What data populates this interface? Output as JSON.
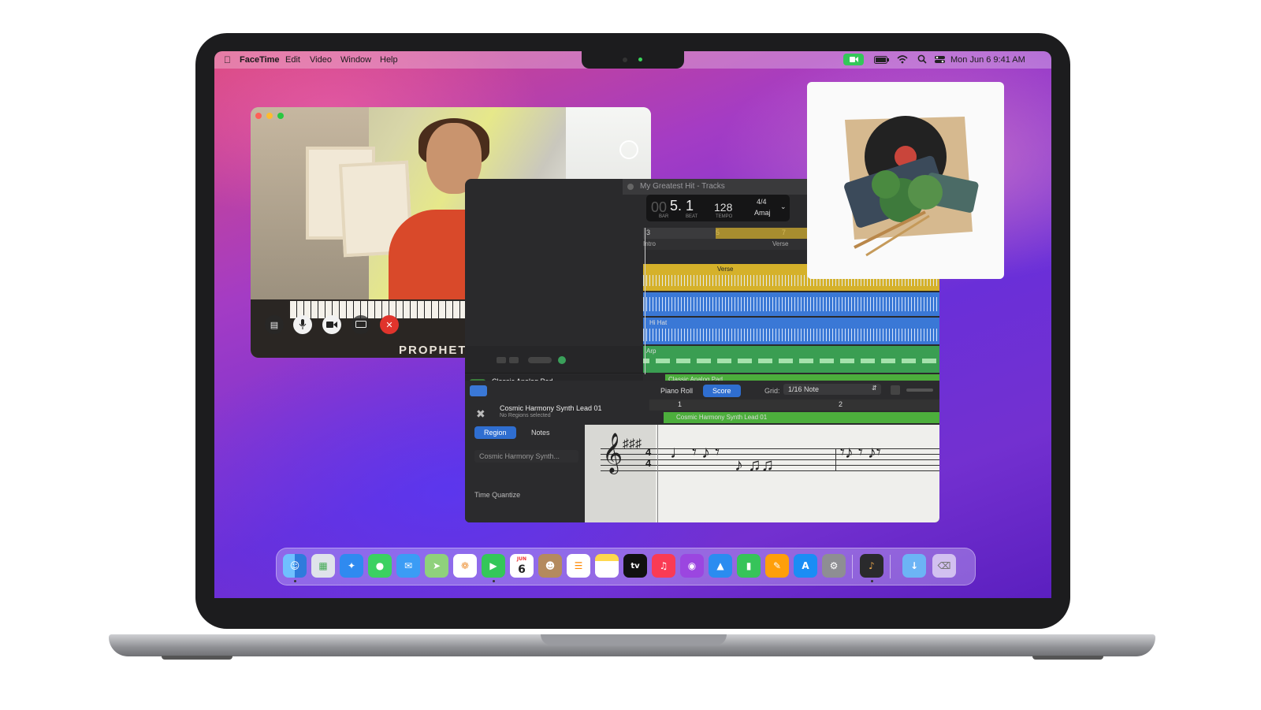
{
  "menubar": {
    "app_name": "FaceTime",
    "menus": [
      "Edit",
      "Video",
      "Window",
      "Help"
    ],
    "datetime": "Mon Jun 6  9:41 AM"
  },
  "facetime": {
    "brand_text": "PROPHET"
  },
  "logic": {
    "title": "My Greatest Hit - Tracks",
    "lcd": {
      "bar_beat": "5. 1",
      "bar_prefix": "00",
      "bar_label": "BAR",
      "beat_label": "BEAT",
      "tempo": "128",
      "tempo_label": "TEMPO",
      "signature": "4/4",
      "key": "Amaj"
    },
    "ruler": [
      "3",
      "5",
      "7"
    ],
    "markers": [
      "Intro",
      "Verse"
    ],
    "regions": {
      "verse": "Verse",
      "hihat": "Hi Hat",
      "arp": "Arp",
      "pad": "Classic Analog Pad"
    },
    "track_name": "Classic Analog Pad",
    "editor": {
      "tabs": [
        "Piano Roll",
        "Score"
      ],
      "active_tab": "Score",
      "grid_label": "Grid:",
      "grid_value": "1/16 Note",
      "track": "Cosmic Harmony Synth Lead 01",
      "status": "No Regions selected",
      "inspector_tabs": [
        "Region",
        "Notes"
      ],
      "region_field": "Cosmic Harmony Synth...",
      "time_quantize": "Time Quantize",
      "bar_numbers": [
        "1",
        "2"
      ],
      "region_label": "Cosmic Harmony Synth Lead 01"
    }
  },
  "dock": {
    "calendar_month": "JUN",
    "calendar_day": "6",
    "tv_label": "tv"
  }
}
